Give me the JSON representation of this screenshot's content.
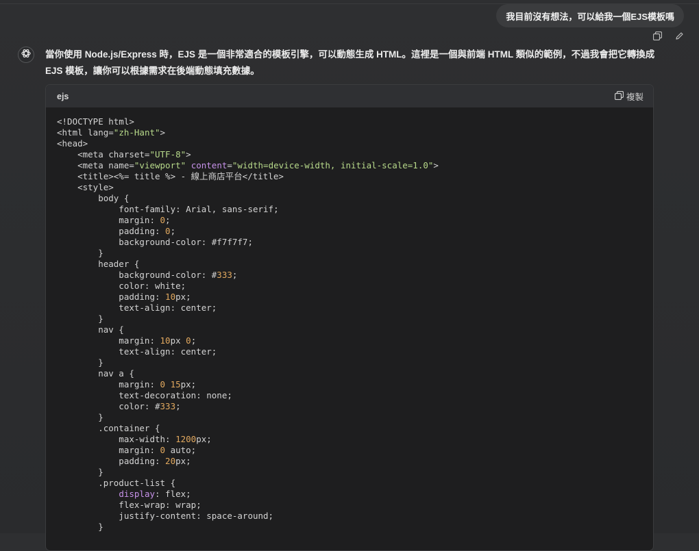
{
  "user_message": "我目前沒有想法，可以給我一個EJS模板嗎",
  "message_actions": [
    "copy-icon",
    "edit-icon"
  ],
  "assistant": {
    "avatar": "openai-logo-icon",
    "text": "當你使用 Node.js/Express 時，EJS 是一個非常適合的模板引擎，可以動態生成 HTML。這裡是一個與前端 HTML 類似的範例，不過我會把它轉換成 EJS 模板，讓你可以根據需求在後端動態填充數據。"
  },
  "code_block": {
    "language": "ejs",
    "copy_label": "複製",
    "lines": [
      [
        [
          "<!DOCTYPE html>",
          ""
        ]
      ],
      [
        [
          "<html lang=",
          ""
        ],
        [
          "\"zh-Hant\"",
          "str"
        ],
        [
          ">",
          ""
        ]
      ],
      [
        [
          "<head>",
          ""
        ]
      ],
      [
        [
          "    <meta charset=",
          ""
        ],
        [
          "\"UTF-8\"",
          "str"
        ],
        [
          ">",
          ""
        ]
      ],
      [
        [
          "    <meta name=",
          ""
        ],
        [
          "\"viewport\"",
          "str"
        ],
        [
          " ",
          ""
        ],
        [
          "content",
          "attr"
        ],
        [
          "=",
          ""
        ],
        [
          "\"width=device-width, initial-scale=1.0\"",
          "str"
        ],
        [
          ">",
          ""
        ]
      ],
      [
        [
          "    <title><%= title %> - 線上商店平台</title>",
          ""
        ]
      ],
      [
        [
          "    <style>",
          ""
        ]
      ],
      [
        [
          "        body {",
          ""
        ]
      ],
      [
        [
          "            font-family: Arial, sans-serif;",
          ""
        ]
      ],
      [
        [
          "            margin: ",
          ""
        ],
        [
          "0",
          "num"
        ],
        [
          ";",
          ""
        ]
      ],
      [
        [
          "            padding: ",
          ""
        ],
        [
          "0",
          "num"
        ],
        [
          ";",
          ""
        ]
      ],
      [
        [
          "            background-color: #f7f7f7;",
          ""
        ]
      ],
      [
        [
          "        }",
          ""
        ]
      ],
      [
        [
          "        header {",
          ""
        ]
      ],
      [
        [
          "            background-color: #",
          ""
        ],
        [
          "333",
          "num"
        ],
        [
          ";",
          ""
        ]
      ],
      [
        [
          "            color: white;",
          ""
        ]
      ],
      [
        [
          "            padding: ",
          ""
        ],
        [
          "10",
          "num"
        ],
        [
          "px;",
          ""
        ]
      ],
      [
        [
          "            text-align: center;",
          ""
        ]
      ],
      [
        [
          "        }",
          ""
        ]
      ],
      [
        [
          "        nav {",
          ""
        ]
      ],
      [
        [
          "            margin: ",
          ""
        ],
        [
          "10",
          "num"
        ],
        [
          "px ",
          ""
        ],
        [
          "0",
          "num"
        ],
        [
          ";",
          ""
        ]
      ],
      [
        [
          "            text-align: center;",
          ""
        ]
      ],
      [
        [
          "        }",
          ""
        ]
      ],
      [
        [
          "        nav a {",
          ""
        ]
      ],
      [
        [
          "            margin: ",
          ""
        ],
        [
          "0 15",
          "num"
        ],
        [
          "px;",
          ""
        ]
      ],
      [
        [
          "            text-decoration: none;",
          ""
        ]
      ],
      [
        [
          "            color: #",
          ""
        ],
        [
          "333",
          "num"
        ],
        [
          ";",
          ""
        ]
      ],
      [
        [
          "        }",
          ""
        ]
      ],
      [
        [
          "        .container {",
          ""
        ]
      ],
      [
        [
          "            max-width: ",
          ""
        ],
        [
          "1200",
          "num"
        ],
        [
          "px;",
          ""
        ]
      ],
      [
        [
          "            margin: ",
          ""
        ],
        [
          "0",
          "num"
        ],
        [
          " auto;",
          ""
        ]
      ],
      [
        [
          "            padding: ",
          ""
        ],
        [
          "20",
          "num"
        ],
        [
          "px;",
          ""
        ]
      ],
      [
        [
          "        }",
          ""
        ]
      ],
      [
        [
          "        .product-list {",
          ""
        ]
      ],
      [
        [
          "            ",
          ""
        ],
        [
          "display",
          "kw"
        ],
        [
          ": flex;",
          ""
        ]
      ],
      [
        [
          "            flex-wrap: wrap;",
          ""
        ]
      ],
      [
        [
          "            justify-content: space-around;",
          ""
        ]
      ],
      [
        [
          "        }",
          ""
        ]
      ]
    ]
  }
}
